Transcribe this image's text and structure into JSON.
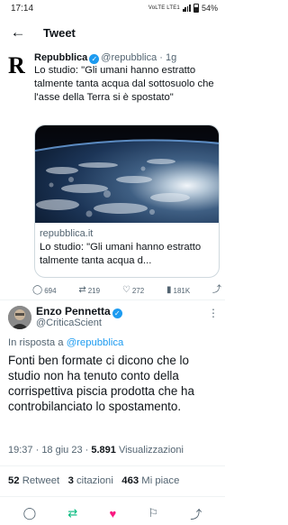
{
  "status_bar": {
    "time": "17:14",
    "network": "VoLTE LTE1",
    "battery": "54%"
  },
  "header": {
    "title": "Tweet"
  },
  "quoted_tweet": {
    "author_name": "Repubblica",
    "handle": "@repubblica",
    "age": "1g",
    "text": "Lo studio: \"Gli umani hanno estratto talmente tanta acqua dal sottosuolo che l'asse della Terra si è spostato\"",
    "card": {
      "domain": "repubblica.it",
      "title": "Lo studio: \"Gli umani hanno estratto talmente tanta acqua d..."
    },
    "actions": {
      "replies": "694",
      "retweets": "219",
      "likes": "272",
      "views": "181K"
    }
  },
  "main_tweet": {
    "author_name": "Enzo Pennetta",
    "handle": "@CriticaScient",
    "reply_prefix": "In risposta a",
    "reply_to": "@repubblica",
    "text": "Fonti ben formate ci dicono che lo studio non ha tenuto conto della corrispettiva piscia prodotta che ha controbilanciato lo spostamento.",
    "time": "19:37",
    "date": "18 giu 23",
    "views_count": "5.891",
    "views_label": "Visualizzazioni"
  },
  "stats": {
    "retweets": "52",
    "retweets_label": "Retweet",
    "quotes": "3",
    "quotes_label": "citazioni",
    "likes": "463",
    "likes_label": "Mi piace"
  },
  "colors": {
    "accent": "#1d9bf0",
    "like": "#f91880",
    "retweet": "#00ba7c",
    "muted": "#536471"
  }
}
